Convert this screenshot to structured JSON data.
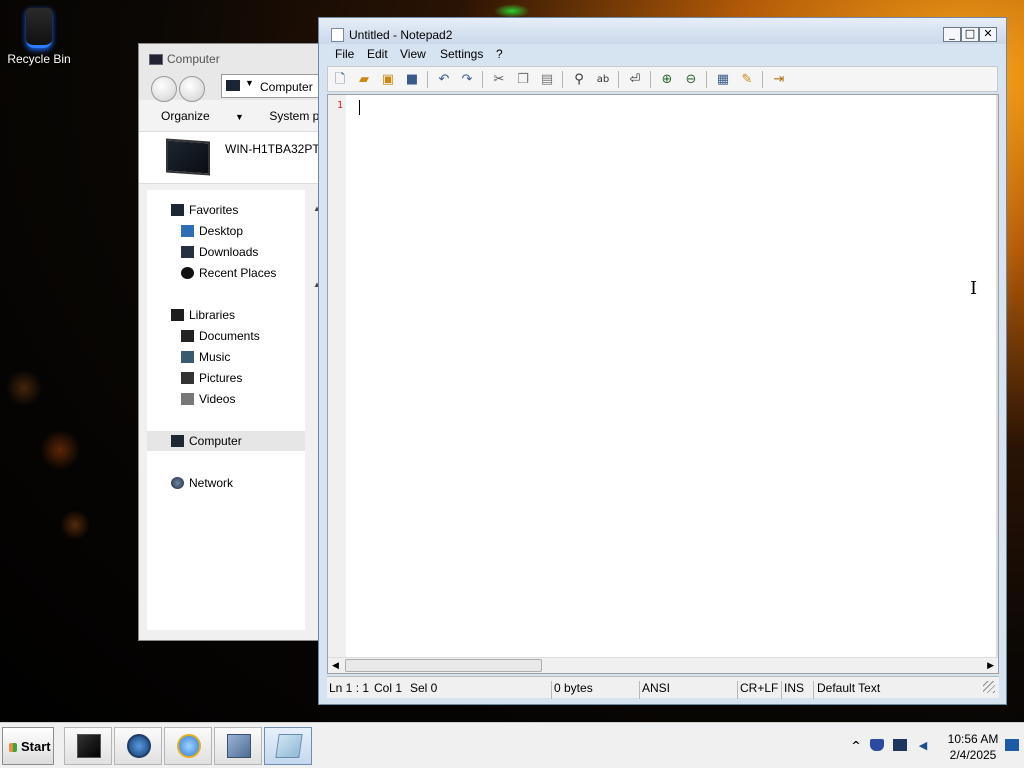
{
  "desktop": {
    "icons": [
      {
        "label": "Recycle Bin",
        "icon": "recycle-bin-icon"
      }
    ]
  },
  "explorer": {
    "title": "Computer",
    "address": "Computer",
    "commands": [
      "Organize",
      "System prope"
    ],
    "computer_name": "WIN-H1TBA32PT",
    "tree": [
      {
        "label": "Favorites",
        "icon": "star-icon"
      },
      {
        "label": "Desktop",
        "icon": "desktop-icon"
      },
      {
        "label": "Downloads",
        "icon": "downloads-icon"
      },
      {
        "label": "Recent Places",
        "icon": "recent-places-icon"
      },
      {
        "label": "Libraries",
        "icon": "libraries-icon"
      },
      {
        "label": "Documents",
        "icon": "documents-icon"
      },
      {
        "label": "Music",
        "icon": "music-icon"
      },
      {
        "label": "Pictures",
        "icon": "pictures-icon"
      },
      {
        "label": "Videos",
        "icon": "videos-icon"
      },
      {
        "label": "Computer",
        "icon": "computer-icon",
        "selected": true
      },
      {
        "label": "Network",
        "icon": "network-icon"
      }
    ]
  },
  "notepad": {
    "title": "Untitled - Notepad2",
    "menu": [
      "File",
      "Edit",
      "View",
      "Settings",
      "?"
    ],
    "toolbar_icons": [
      "new-file-icon",
      "open-folder-icon",
      "browse-icon",
      "save-icon",
      "undo-icon",
      "redo-icon",
      "cut-icon",
      "copy-icon",
      "paste-icon",
      "find-icon",
      "replace-icon",
      "word-wrap-icon",
      "zoom-in-icon",
      "zoom-out-icon",
      "select-scheme-icon",
      "customize-scheme-icon",
      "exit-icon"
    ],
    "line_number": "1",
    "status": {
      "position": "Ln 1 : 1",
      "column": "Col 1",
      "selection": "Sel 0",
      "size": "0 bytes",
      "encoding": "ANSI",
      "line_ending": "CR+LF",
      "mode": "INS",
      "scheme": "Default Text"
    }
  },
  "taskbar": {
    "start_label": "Start",
    "clock_time": "10:56 AM",
    "clock_date": "2/4/2025",
    "tray_expand": "^"
  },
  "colors": {
    "line_number": "#dd2222",
    "title_bar": "#cad8ea",
    "accent": "#2d7bff"
  }
}
